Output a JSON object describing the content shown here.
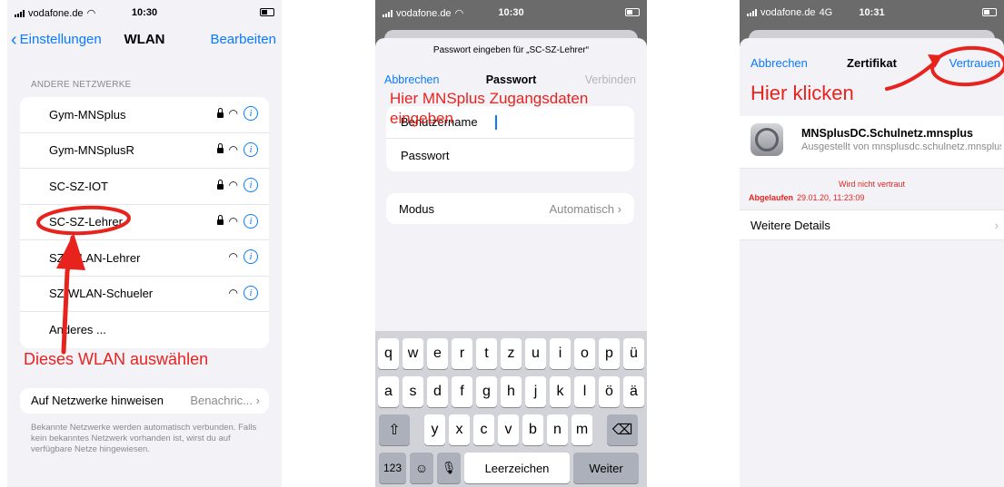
{
  "panel1": {
    "status": {
      "carrier": "vodafone.de",
      "time": "10:30"
    },
    "nav": {
      "back": "Einstellungen",
      "title": "WLAN",
      "action": "Bearbeiten"
    },
    "section_header": "ANDERE NETZWERKE",
    "networks": [
      {
        "name": "Gym-MNSplus",
        "locked": true
      },
      {
        "name": "Gym-MNSplusR",
        "locked": true
      },
      {
        "name": "SC-SZ-IOT",
        "locked": true
      },
      {
        "name": "SC-SZ-Lehrer",
        "locked": true
      },
      {
        "name": "SZ-WLAN-Lehrer",
        "locked": false
      },
      {
        "name": "SZ-WLAN-Schueler",
        "locked": false
      },
      {
        "name": "Anderes ..."
      }
    ],
    "annotation": "Dieses WLAN auswählen",
    "hint": {
      "label": "Auf Netzwerke hinweisen",
      "value": "Benachric..."
    },
    "footnote": "Bekannte Netzwerke werden automatisch verbunden. Falls kein bekanntes Netzwerk vorhanden ist, wirst du auf verfügbare Netze hingewiesen."
  },
  "panel2": {
    "status": {
      "carrier": "vodafone.de",
      "time": "10:30"
    },
    "prompt": "Passwort eingeben für „SC-SZ-Lehrer“",
    "nav": {
      "cancel": "Abbrechen",
      "title": "Passwort",
      "connect": "Verbinden"
    },
    "annotation_line1": "Hier MNSplus Zugangsdaten",
    "annotation_line2": "eingeben",
    "fields": {
      "username": "Benutzername",
      "password": "Passwort"
    },
    "mode": {
      "label": "Modus",
      "value": "Automatisch"
    },
    "keyboard": {
      "row1": [
        "q",
        "w",
        "e",
        "r",
        "t",
        "z",
        "u",
        "i",
        "o",
        "p",
        "ü"
      ],
      "row2": [
        "a",
        "s",
        "d",
        "f",
        "g",
        "h",
        "j",
        "k",
        "l",
        "ö",
        "ä"
      ],
      "row3": [
        "y",
        "x",
        "c",
        "v",
        "b",
        "n",
        "m"
      ],
      "numbers": "123",
      "space": "Leerzeichen",
      "next": "Weiter"
    }
  },
  "panel3": {
    "status": {
      "carrier": "vodafone.de",
      "network": "4G",
      "time": "10:31"
    },
    "nav": {
      "cancel": "Abbrechen",
      "title": "Zertifikat",
      "trust": "Vertrauen"
    },
    "annotation": "Hier klicken",
    "certificate": {
      "name": "MNSplusDC.Schulnetz.mnsplus",
      "issuer": "Ausgestellt von mnsplusdc.schulnetz.mnsplus"
    },
    "trust_status": "Wird nicht vertraut",
    "expired_label": "Abgelaufen",
    "expired_date": "29.01.20, 11:23:09",
    "details": "Weitere Details"
  },
  "colors": {
    "ios_blue": "#0a7aff",
    "annotation_red": "#e8231e",
    "grouped_bg": "#f2f2f7"
  }
}
